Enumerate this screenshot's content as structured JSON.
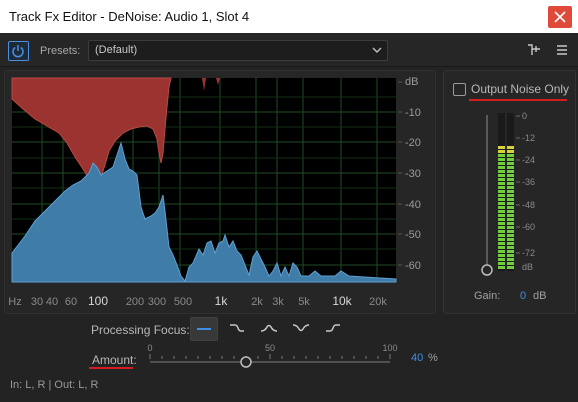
{
  "window": {
    "title": "Track Fx Editor - DeNoise: Audio 1, Slot 4"
  },
  "toolbar": {
    "power_icon": "power-icon",
    "presets_label": "Presets:",
    "preset_value": "(Default)",
    "dropdown_icon": "chevron-down-icon",
    "routing_icon": "routing-icon",
    "menu_icon": "hamburger-menu-icon"
  },
  "graph": {
    "db_unit": "dB",
    "db_ticks": [
      "-10",
      "-20",
      "-30",
      "-40",
      "-50",
      "-60"
    ],
    "freq_ticks": [
      "Hz",
      "30",
      "40",
      "60",
      "100",
      "200",
      "300",
      "500",
      "1k",
      "2k",
      "3k",
      "5k",
      "10k",
      "20k"
    ],
    "noise_color": "#9b3330",
    "signal_color": "#3f7ca8",
    "grid_color": "#245a2a"
  },
  "output_noise_only": {
    "label": "Output Noise Only",
    "checked": false
  },
  "meter": {
    "scale": [
      "0",
      "-12",
      "-24",
      "-36",
      "-48",
      "-60",
      "-72",
      "dB"
    ],
    "gain_label": "Gain:",
    "gain_value": "0",
    "gain_unit": "dB",
    "gain_fader_level": 0.0
  },
  "processing_focus": {
    "label": "Processing Focus:",
    "options": [
      "flat-focus-icon",
      "low-focus-icon",
      "mid-focus-icon",
      "mid-cut-focus-icon",
      "high-focus-icon"
    ],
    "selected": 0
  },
  "amount": {
    "label": "Amount:",
    "scale": [
      "0",
      "50",
      "100"
    ],
    "value": "40",
    "unit": "%",
    "level": 0.4
  },
  "footer": {
    "io": "In: L, R | Out: L, R"
  },
  "accent": {
    "blue": "#3d8ee8",
    "annotation_red": "#d41e1e"
  }
}
